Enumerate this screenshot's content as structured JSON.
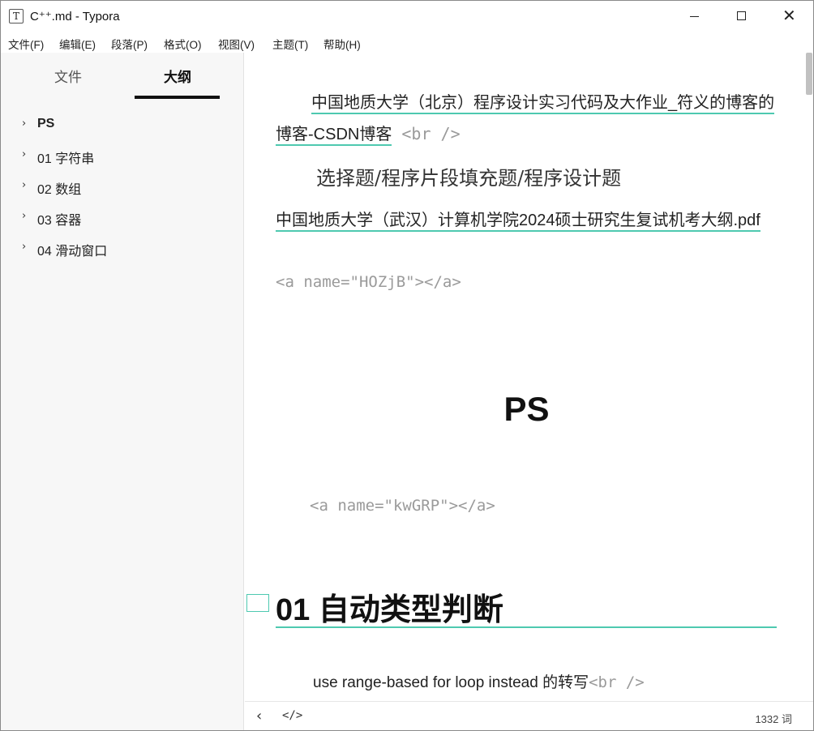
{
  "window": {
    "title": "C⁺⁺.md - Typora",
    "app_icon": "T"
  },
  "menu": [
    "文件(F)",
    "编辑(E)",
    "段落(P)",
    "格式(O)",
    "视图(V)",
    "主题(T)",
    "帮助(H)"
  ],
  "sidebar": {
    "tabs": {
      "files": "文件",
      "outline": "大纲"
    },
    "outline": [
      {
        "label": "PS",
        "bold": true
      },
      {
        "label": "01 字符串"
      },
      {
        "label": "02 数组"
      },
      {
        "label": "03 容器"
      },
      {
        "label": "04 滑动窗口"
      }
    ]
  },
  "editor": {
    "p1_link": "中国地质大学（北京）程序设计实习代码及大作业_符义的博客的博客-CSDN博客",
    "p1_tag": " <br />",
    "p2": "选择题/程序片段填充题/程序设计题",
    "p3_link": "中国地质大学（武汉）计算机学院2024硕士研究生复试机考大纲.pdf",
    "anchor1": "<a name=\"HOZjB\"></a>",
    "heading_ps": "PS",
    "anchor2": "<a name=\"kwGRP\"></a>",
    "heading_01": "01 自动类型判断",
    "p_last_text": "use range-based for loop instead  的转写",
    "p_last_tag": "<br />"
  },
  "status": {
    "back_icon": "chevron-left-icon",
    "source_icon": "source-code-icon",
    "word_count": "1332 词"
  },
  "colors": {
    "accent": "#4ec9b0",
    "sidebar_bg": "#f7f7f7",
    "tag_gray": "#9a9a9a"
  }
}
